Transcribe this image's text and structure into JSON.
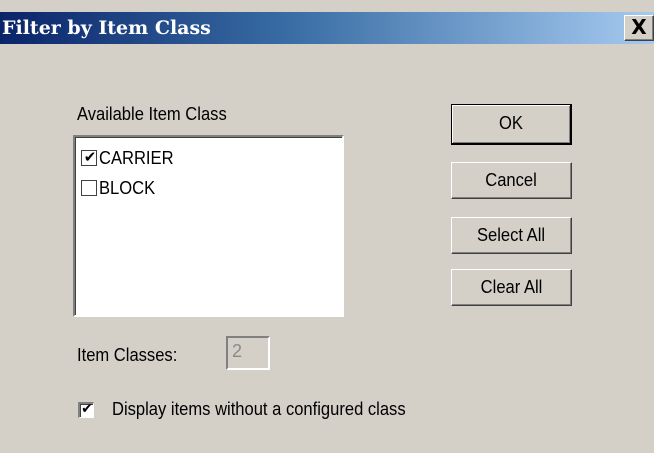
{
  "window": {
    "title": "Filter by Item Class",
    "close_label": "X"
  },
  "list": {
    "label": "Available Item Class",
    "items": [
      {
        "label": "CARRIER",
        "checked": true,
        "check_mark": "✔"
      },
      {
        "label": "BLOCK",
        "checked": false,
        "check_mark": ""
      }
    ]
  },
  "buttons": {
    "ok": "OK",
    "cancel": "Cancel",
    "select_all": "Select All",
    "clear_all": "Clear All"
  },
  "count": {
    "label": "Item Classes:",
    "value": "2"
  },
  "display_option": {
    "label": "Display items without a configured class",
    "checked": true,
    "check_mark": "✔"
  },
  "colors": {
    "title_gradient_start": "#0a246a",
    "title_gradient_end": "#a6caf0",
    "face": "#d4d0c8"
  }
}
